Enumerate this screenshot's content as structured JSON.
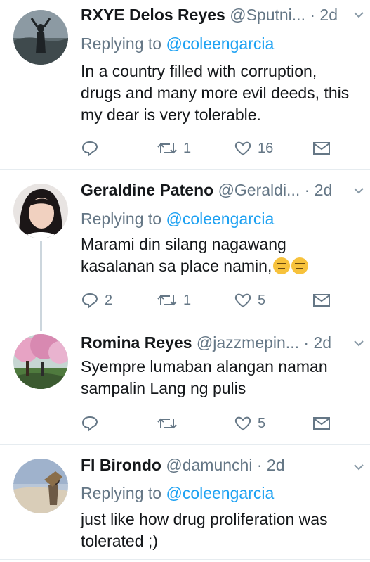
{
  "tweets": [
    {
      "name": "RXYE Delos Reyes",
      "handle": "@Sputni...",
      "dot": "·",
      "time": "2d",
      "reply_prefix": "Replying to",
      "reply_to": "@coleengarcia",
      "body": "In a country filled with corruption, drugs and many more evil deeds, this my dear is very tolerable.",
      "replies": "",
      "retweets": "1",
      "likes": "16"
    },
    {
      "name": "Geraldine Pateno",
      "handle": "@Geraldi...",
      "dot": "·",
      "time": "2d",
      "reply_prefix": "Replying to",
      "reply_to": "@coleengarcia",
      "body": "Marami din silang nagawang kasalanan sa place namin,",
      "emoji": "😑😑",
      "replies": "2",
      "retweets": "1",
      "likes": "5"
    },
    {
      "name": "Romina Reyes",
      "handle": "@jazzmepin...",
      "dot": "·",
      "time": "2d",
      "body": "Syempre lumaban alangan naman sampalin Lang ng pulis",
      "replies": "",
      "retweets": "",
      "likes": "5"
    },
    {
      "name": "FI Birondo",
      "handle": "@damunchi",
      "dot": "·",
      "time": "2d",
      "reply_prefix": "Replying to",
      "reply_to": "@coleengarcia",
      "body": "just like how drug proliferation was tolerated ;)"
    }
  ],
  "icons": {
    "reply": "reply-icon",
    "retweet": "retweet-icon",
    "like": "heart-icon",
    "dm": "envelope-icon",
    "menu": "chevron-down-icon"
  },
  "colors": {
    "text": "#14171a",
    "muted": "#657786",
    "link": "#1da1f2",
    "divider": "#e6ecf0"
  }
}
